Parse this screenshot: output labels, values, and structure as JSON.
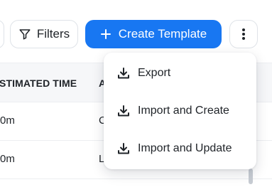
{
  "toolbar": {
    "filters_label": "Filters",
    "create_label": "Create Template",
    "filters_icon": "funnel-icon",
    "create_icon": "plus-icon",
    "more_icon": "kebab-vertical-icon"
  },
  "table": {
    "headers": [
      "STIMATED TIME",
      "A"
    ],
    "rows": [
      {
        "time": "0m",
        "next": "C"
      },
      {
        "time": "0m",
        "next": "L"
      }
    ]
  },
  "menu": {
    "items": [
      {
        "label": "Export",
        "icon": "download-icon"
      },
      {
        "label": "Import and Create",
        "icon": "download-icon"
      },
      {
        "label": "Import and Update",
        "icon": "download-icon"
      }
    ]
  },
  "colors": {
    "primary": "#1877f2",
    "border": "#dfe3e8",
    "header_bg": "#f6f7f9"
  }
}
